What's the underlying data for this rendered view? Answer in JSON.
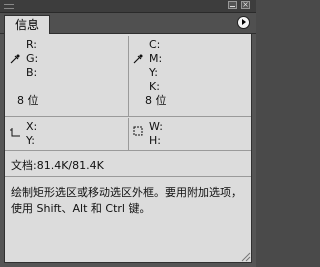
{
  "panel": {
    "tab_label": "信息",
    "menu_icon": "flyout-menu-icon"
  },
  "rgb": {
    "labels": [
      "R:",
      "G:",
      "B:"
    ],
    "bits": "8 位"
  },
  "cmyk": {
    "labels": [
      "C:",
      "M:",
      "Y:",
      "K:"
    ],
    "bits": "8 位"
  },
  "position": {
    "x_label": "X:",
    "y_label": "Y:"
  },
  "size": {
    "w_label": "W:",
    "h_label": "H:"
  },
  "document": {
    "label": "文档:",
    "value": "81.4K/81.4K"
  },
  "hint": {
    "text": "绘制矩形选区或移动选区外框。要用附加选项，使用 Shift、Alt 和 Ctrl 键。"
  }
}
